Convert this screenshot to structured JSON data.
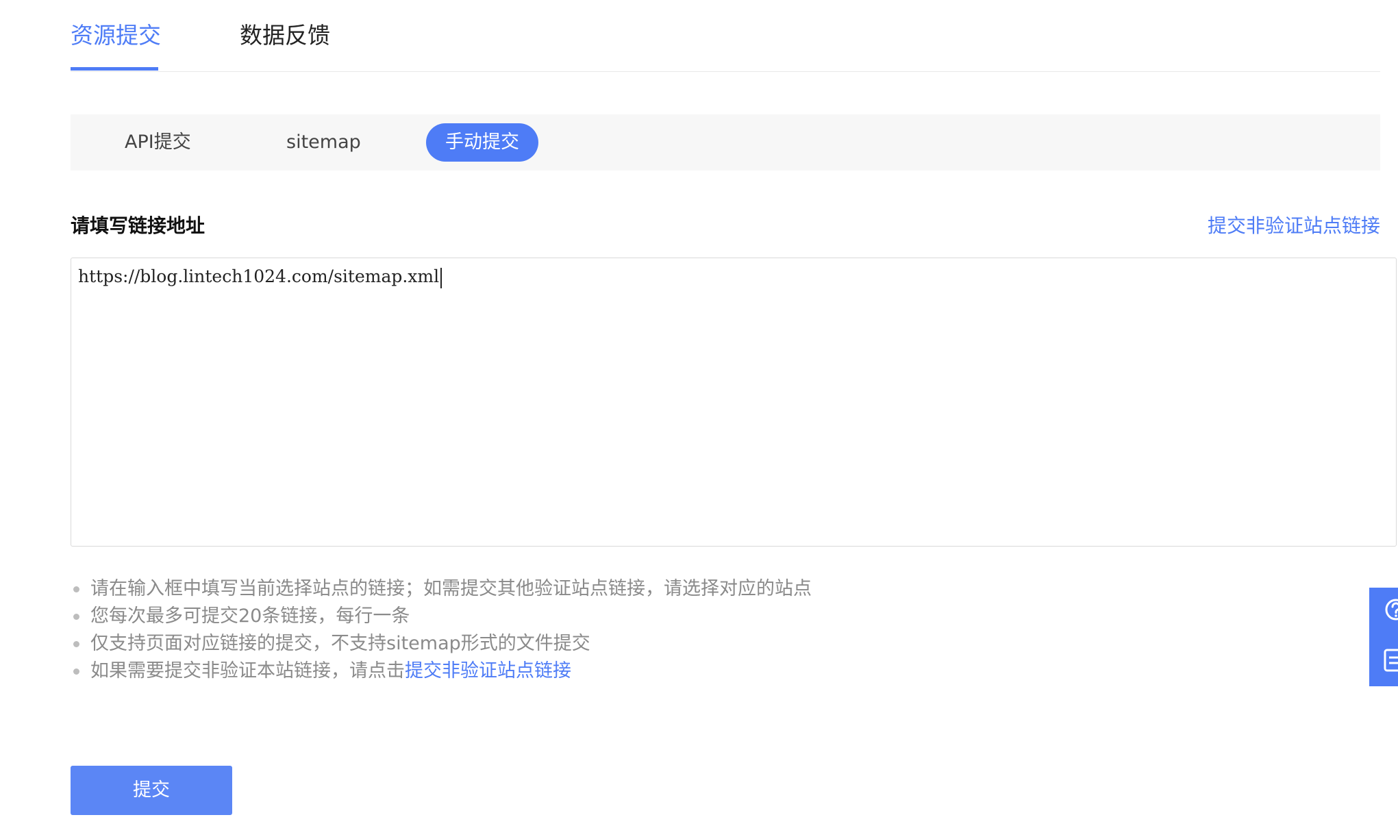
{
  "top_tabs": {
    "active": "资源提交",
    "items": [
      {
        "label": "资源提交"
      },
      {
        "label": "数据反馈"
      }
    ]
  },
  "sub_tabs": {
    "active": "手动提交",
    "items": [
      {
        "label": "API提交"
      },
      {
        "label": "sitemap"
      },
      {
        "label": "手动提交"
      }
    ]
  },
  "form": {
    "title": "请填写链接地址",
    "side_link": "提交非验证站点链接",
    "url_value": "https://blog.lintech1024.com/sitemap.xml"
  },
  "tips": {
    "items": [
      {
        "text": "请在输入框中填写当前选择站点的链接；如需提交其他验证站点链接，请选择对应的站点"
      },
      {
        "text": "您每次最多可提交20条链接，每行一条"
      },
      {
        "text": "仅支持页面对应链接的提交，不支持sitemap形式的文件提交"
      },
      {
        "text": "如果需要提交非验证本站链接，请点击",
        "link": "提交非验证站点链接"
      }
    ]
  },
  "submit_label": "提交",
  "float_panel": {
    "icons": [
      "help-icon",
      "feedback-icon"
    ]
  },
  "colors": {
    "accent": "#4e7cf6",
    "button": "#5b86f5",
    "tip_text": "#8a8a8a",
    "subbar_bg": "#f7f7f7"
  }
}
